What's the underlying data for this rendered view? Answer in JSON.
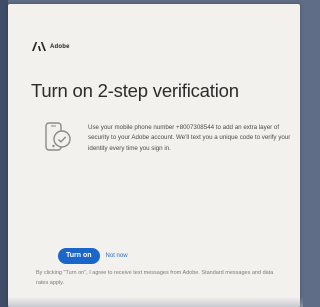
{
  "brand": {
    "name": "Adobe",
    "icon": "adobe-logo"
  },
  "dialog": {
    "title": "Turn on 2-step verification",
    "description": "Use your mobile phone number +8007308544 to add an extra layer of security to your Adobe account. We'll text you a unique code to verify your identity every time you sign in.",
    "icon": "phone-icon"
  },
  "actions": {
    "primary_label": "Turn on",
    "secondary_label": "Not now"
  },
  "footer": {
    "text": "By clicking \"Turn on\", I agree to receive text messages from Adobe. Standard messages and data rates apply."
  },
  "colors": {
    "accent": "#1a66c9",
    "background": "#f3f1ee",
    "frame": "#5f6d86"
  }
}
